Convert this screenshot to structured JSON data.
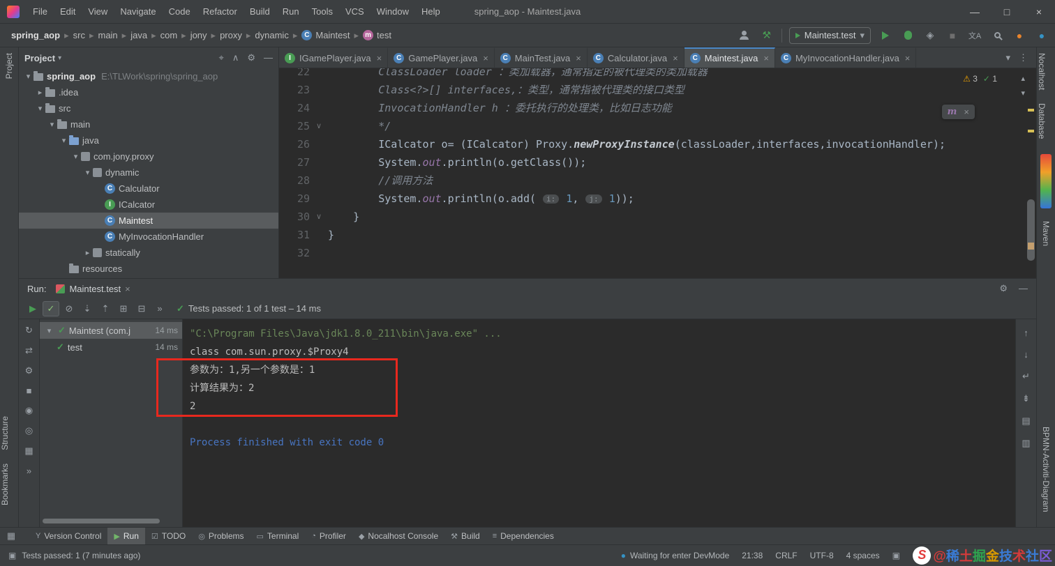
{
  "colors": {
    "accent": "#4a88c7",
    "green": "#499c54",
    "red": "#db5860",
    "yellow": "#eda200",
    "annotation_red": "#e8281e"
  },
  "icons": {
    "chevron-down": "▾",
    "chevron-right": "▸",
    "chevron-up": "▴",
    "close": "×",
    "minimize": "—",
    "maximize": "□",
    "gear": "⚙",
    "kebab": "⋮",
    "warning": "⚠",
    "check": "✓",
    "locate": "⌖",
    "collapse-all": "∧",
    "hide": "—",
    "hammer": "⚒",
    "coverage": "◈",
    "stop": "■",
    "translate": "文A",
    "dot": "●",
    "play": "▶",
    "ignore": "⊘",
    "sort-down": "⇣",
    "sort-up": "⇡",
    "expand": "⊞",
    "collapse": "⊟",
    "more": "»",
    "rerun": "↻",
    "swap": "⇄",
    "screenshot": "◉",
    "rings": "◎",
    "grid": "▦",
    "up": "↑",
    "down": "↓",
    "wrap": "↵",
    "scroll-end": "⇟",
    "print": "▤",
    "trash": "▥",
    "branch": "Y",
    "todo": "☑",
    "problems": "◎",
    "terminal": "▭",
    "profiler": "◔",
    "diamond": "◆",
    "deps": "≡",
    "monitor": "▣",
    "lock": "▣",
    "fold": "∨"
  },
  "window": {
    "title": "spring_aop - Maintest.java",
    "menus": [
      "File",
      "Edit",
      "View",
      "Navigate",
      "Code",
      "Refactor",
      "Build",
      "Run",
      "Tools",
      "VCS",
      "Window",
      "Help"
    ]
  },
  "navbar": {
    "breadcrumbs": [
      {
        "label": "spring_aop",
        "bold": true
      },
      {
        "label": "src"
      },
      {
        "label": "main"
      },
      {
        "label": "java"
      },
      {
        "label": "com"
      },
      {
        "label": "jony"
      },
      {
        "label": "proxy"
      },
      {
        "label": "dynamic"
      },
      {
        "label": "Maintest",
        "icon": "class"
      },
      {
        "label": "test",
        "icon": "method"
      }
    ],
    "run_config": "Maintest.test"
  },
  "left_stripe": {
    "top": [
      "Project"
    ],
    "bottom": [
      "Structure",
      "Bookmarks"
    ]
  },
  "right_stripe": {
    "top": [
      "Nocalhost",
      "Database"
    ],
    "middle": [
      "Maven"
    ],
    "bottom": [
      "BPMN-Activiti-Diagram"
    ]
  },
  "project_panel": {
    "title": "Project",
    "tree": [
      {
        "label": "spring_aop",
        "path": "E:\\TLWork\\spring\\spring_aop",
        "icon": "folder",
        "depth": 0,
        "chevron": "down",
        "bold": true
      },
      {
        "label": ".idea",
        "icon": "folder",
        "depth": 1,
        "chevron": "right"
      },
      {
        "label": "src",
        "icon": "folder",
        "depth": 1,
        "chevron": "down"
      },
      {
        "label": "main",
        "icon": "folder",
        "depth": 2,
        "chevron": "down"
      },
      {
        "label": "java",
        "icon": "src-folder",
        "depth": 3,
        "chevron": "down"
      },
      {
        "label": "com.jony.proxy",
        "icon": "package",
        "depth": 4,
        "chevron": "down"
      },
      {
        "label": "dynamic",
        "icon": "package",
        "depth": 5,
        "chevron": "down"
      },
      {
        "label": "Calculator",
        "icon": "class",
        "depth": 6
      },
      {
        "label": "ICalcator",
        "icon": "interface",
        "depth": 6
      },
      {
        "label": "Maintest",
        "icon": "class",
        "depth": 6,
        "selected": true
      },
      {
        "label": "MyInvocationHandler",
        "icon": "class",
        "depth": 6
      },
      {
        "label": "statically",
        "icon": "package",
        "depth": 5,
        "chevron": "right"
      },
      {
        "label": "resources",
        "icon": "folder",
        "depth": 3
      }
    ]
  },
  "editor": {
    "tabs": [
      {
        "label": "IGamePlayer.java",
        "icon": "interface"
      },
      {
        "label": "GamePlayer.java",
        "icon": "class"
      },
      {
        "label": "MainTest.java",
        "icon": "class"
      },
      {
        "label": "Calculator.java",
        "icon": "class"
      },
      {
        "label": "Maintest.java",
        "icon": "class",
        "active": true
      },
      {
        "label": "MyInvocationHandler.java",
        "icon": "class"
      }
    ],
    "inspections": {
      "warnings": "3",
      "passed": "1"
    },
    "float_widget": "m",
    "code": [
      {
        "num": "22",
        "indent": 8,
        "segments": [
          {
            "t": "ClassLoader loader ：类加载器，通常指定的被代理类的类加载器",
            "s": "comment"
          }
        ]
      },
      {
        "num": "23",
        "indent": 8,
        "segments": [
          {
            "t": "Class<?>[] interfaces,：类型，通常指被代理类的接口类型",
            "s": "comment"
          }
        ]
      },
      {
        "num": "24",
        "indent": 8,
        "segments": [
          {
            "t": "InvocationHandler h ：委托执行的处理类，比如日志功能",
            "s": "comment"
          }
        ]
      },
      {
        "num": "25",
        "indent": 8,
        "fold": true,
        "segments": [
          {
            "t": "*/",
            "s": "comment"
          }
        ]
      },
      {
        "num": "26",
        "indent": 8,
        "segments": [
          {
            "t": "ICalcator o= (ICalcator) Proxy.",
            "s": "plain"
          },
          {
            "t": "newProxyInstance",
            "s": "static-method"
          },
          {
            "t": "(classLoader,interfaces,invocationHandler);",
            "s": "plain"
          }
        ]
      },
      {
        "num": "27",
        "indent": 8,
        "segments": [
          {
            "t": "System.",
            "s": "plain"
          },
          {
            "t": "out",
            "s": "static-field"
          },
          {
            "t": ".println(o.getClass());",
            "s": "plain"
          }
        ]
      },
      {
        "num": "28",
        "indent": 8,
        "segments": [
          {
            "t": "//调用方法",
            "s": "comment"
          }
        ]
      },
      {
        "num": "29",
        "indent": 8,
        "segments": [
          {
            "t": "System.",
            "s": "plain"
          },
          {
            "t": "out",
            "s": "static-field"
          },
          {
            "t": ".println(o.add( ",
            "s": "plain"
          },
          {
            "t": "i:",
            "s": "hint"
          },
          {
            "t": " 1",
            "s": "number"
          },
          {
            "t": ", ",
            "s": "plain"
          },
          {
            "t": "j:",
            "s": "hint"
          },
          {
            "t": " 1",
            "s": "number"
          },
          {
            "t": "));",
            "s": "plain"
          }
        ]
      },
      {
        "num": "30",
        "indent": 4,
        "fold": true,
        "segments": [
          {
            "t": "}",
            "s": "plain"
          }
        ]
      },
      {
        "num": "31",
        "indent": 0,
        "segments": [
          {
            "t": "}",
            "s": "plain"
          }
        ]
      },
      {
        "num": "32",
        "indent": 0,
        "segments": []
      }
    ]
  },
  "run_panel": {
    "label": "Run:",
    "tab": "Maintest.test",
    "status": "Tests passed: 1 of 1 test – 14 ms",
    "left_icons": [
      {
        "name": "rerun-icon",
        "icon": "rerun"
      },
      {
        "name": "rerun-failed-icon",
        "icon": "swap"
      },
      {
        "name": "wrench-icon",
        "icon": "gear"
      },
      {
        "name": "stop-icon",
        "icon": "stop"
      },
      {
        "name": "screenshot-icon",
        "icon": "screenshot"
      },
      {
        "name": "profiler-icon",
        "icon": "rings"
      },
      {
        "name": "layout-icon",
        "icon": "grid"
      },
      {
        "name": "more-icon",
        "icon": "more"
      }
    ],
    "toolbar_icons": [
      {
        "name": "rerun-tests-icon",
        "icon": "play",
        "cls": "green"
      },
      {
        "name": "show-passed-icon",
        "icon": "check",
        "pressed": true
      },
      {
        "name": "show-ignored-icon",
        "icon": "ignore"
      },
      {
        "name": "sort-alphabetically-icon",
        "icon": "sort-down"
      },
      {
        "name": "sort-by-duration-icon",
        "icon": "sort-up"
      },
      {
        "name": "expand-all-icon",
        "icon": "expand"
      },
      {
        "name": "collapse-all-icon",
        "icon": "collapse"
      },
      {
        "name": "more-options-icon",
        "icon": "more"
      }
    ],
    "right_icons": [
      {
        "name": "scroll-up-icon",
        "icon": "up"
      },
      {
        "name": "scroll-down-icon",
        "icon": "down"
      },
      {
        "name": "soft-wrap-icon",
        "icon": "wrap"
      },
      {
        "name": "scroll-to-end-icon",
        "icon": "scroll-end"
      },
      {
        "name": "print-icon",
        "icon": "print"
      },
      {
        "name": "clear-all-icon",
        "icon": "trash"
      }
    ],
    "tests": [
      {
        "label": "Maintest (com.j",
        "time": "14 ms",
        "depth": 0,
        "chevron": "down",
        "selected": true
      },
      {
        "label": "test",
        "time": "14 ms",
        "depth": 1
      }
    ],
    "console": [
      {
        "text": "\"C:\\Program Files\\Java\\jdk1.8.0_211\\bin\\java.exe\" ...",
        "style": "command"
      },
      {
        "text": "class com.sun.proxy.$Proxy4",
        "style": "stdout"
      },
      {
        "text": "参数为：1,另一个参数是：1",
        "style": "stdout"
      },
      {
        "text": "计算结果为：2",
        "style": "stdout"
      },
      {
        "text": "2",
        "style": "stdout"
      },
      {
        "text": "",
        "style": "stdout"
      },
      {
        "text": "Process finished with exit code 0",
        "style": "system"
      }
    ]
  },
  "bottom_bar": {
    "buttons": [
      {
        "label": "Version Control",
        "icon": "branch"
      },
      {
        "label": "Run",
        "icon": "play",
        "active": true
      },
      {
        "label": "TODO",
        "icon": "todo"
      },
      {
        "label": "Problems",
        "icon": "problems"
      },
      {
        "label": "Terminal",
        "icon": "terminal"
      },
      {
        "label": "Profiler",
        "icon": "profiler"
      },
      {
        "label": "Nocalhost Console",
        "icon": "diamond"
      },
      {
        "label": "Build",
        "icon": "hammer"
      },
      {
        "label": "Dependencies",
        "icon": "deps"
      }
    ]
  },
  "status_bar": {
    "left": "Tests passed: 1 (7 minutes ago)",
    "devmode": "Waiting for enter DevMode",
    "time": "21:38",
    "line_ending": "CRLF",
    "encoding": "UTF-8",
    "indent_info": "4 spaces"
  },
  "watermark": {
    "logo": "S",
    "chars": [
      {
        "c": "@",
        "col": "#d43b3b"
      },
      {
        "c": "稀",
        "col": "#3a7bd5"
      },
      {
        "c": "土",
        "col": "#d43b3b"
      },
      {
        "c": "掘",
        "col": "#2ea44f"
      },
      {
        "c": "金",
        "col": "#d89a00"
      },
      {
        "c": "技",
        "col": "#3a7bd5"
      },
      {
        "c": "术",
        "col": "#d43b3b"
      },
      {
        "c": "社",
        "col": "#3a7bd5"
      },
      {
        "c": "区",
        "col": "#7b5cd6"
      }
    ]
  }
}
